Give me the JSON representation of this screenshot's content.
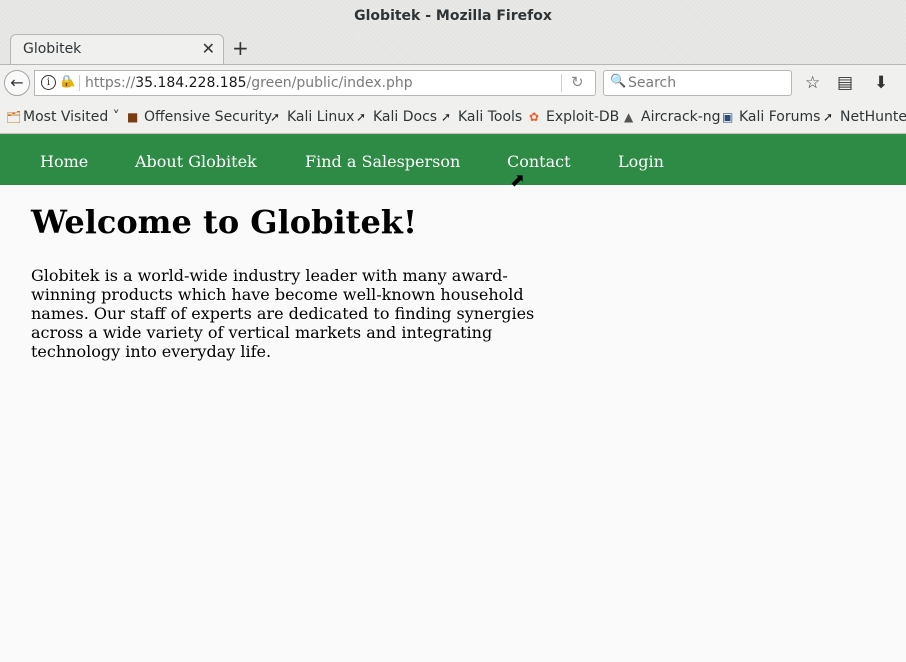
{
  "window": {
    "title": "Globitek - Mozilla Firefox"
  },
  "tabs": [
    {
      "label": "Globitek",
      "close": "✕"
    }
  ],
  "new_tab": "+",
  "navbar": {
    "url_scheme": "https://",
    "url_host": "35.184.228.185",
    "url_path": "/green/public/index.php",
    "search_placeholder": "Search"
  },
  "bookmarks": [
    {
      "label": "Most Visited",
      "icon": "folder-icon"
    },
    {
      "label": "Offensive Security",
      "icon": "offsec-icon"
    },
    {
      "label": "Kali Linux",
      "icon": "kali-dragon-icon"
    },
    {
      "label": "Kali Docs",
      "icon": "kali-dragon-icon"
    },
    {
      "label": "Kali Tools",
      "icon": "kali-dragon-icon"
    },
    {
      "label": "Exploit-DB",
      "icon": "exploitdb-icon"
    },
    {
      "label": "Aircrack-ng",
      "icon": "aircrack-icon"
    },
    {
      "label": "Kali Forums",
      "icon": "kali-forums-icon"
    },
    {
      "label": "NetHunter",
      "icon": "kali-dragon-icon"
    }
  ],
  "site_nav": [
    {
      "label": "Home"
    },
    {
      "label": "About Globitek"
    },
    {
      "label": "Find a Salesperson"
    },
    {
      "label": "Contact"
    },
    {
      "label": "Login"
    }
  ],
  "page": {
    "heading": "Welcome to Globitek!",
    "intro": "Globitek is a world-wide industry leader with many award-winning products which have become well-known household names. Our staff of experts are dedicated to finding synergies across a wide variety of vertical markets and integrating technology into everyday life."
  },
  "colors": {
    "nav_bg": "#2e8b45",
    "nav_text": "#ffffff"
  }
}
